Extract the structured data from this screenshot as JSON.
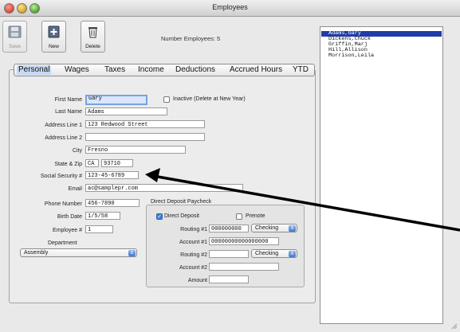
{
  "window": {
    "title": "Employees"
  },
  "toolbar": {
    "save": "Save",
    "new": "New",
    "delete": "Delete",
    "num_employees": "Number Employees:  5"
  },
  "tabs": [
    "Personal",
    "Wages",
    "Taxes",
    "Income",
    "Deductions",
    "Accrued Hours",
    "YTD"
  ],
  "form": {
    "first_name_label": "First Name",
    "first_name": "Gary",
    "inactive_label": "Inactive (Delete at New Year)",
    "last_name_label": "Last Name",
    "last_name": "Adams",
    "address1_label": "Address Line 1",
    "address1": "123 Redwood Street",
    "address2_label": "Address Line 2",
    "address2": "",
    "city_label": "City",
    "city": "Fresno",
    "state_zip_label": "State & Zip",
    "state": "CA",
    "zip": "93710",
    "ssn_label": "Social Security #",
    "ssn": "123-45-6789",
    "email_label": "Email",
    "email": "ac@samplepr.com",
    "phone_label": "Phone Number",
    "phone": "456-7890",
    "birth_label": "Birth Date",
    "birth": "1/5/58",
    "employee_no_label": "Employee #",
    "employee_no": "1",
    "department_label": "Department",
    "department": "Assembly"
  },
  "direct_deposit": {
    "title": "Direct Deposit Paycheck",
    "dd_label": "Direct Deposit",
    "prenote_label": "Prenote",
    "routing1_label": "Routing #1",
    "routing1": "000000000",
    "type1": "Checking",
    "account1_label": "Account #1",
    "account1": "00000000000000000",
    "routing2_label": "Routing #2",
    "routing2": "",
    "type2": "Checking",
    "account2_label": "Account #2",
    "account2": "",
    "amount_label": "Amount",
    "amount": ""
  },
  "employees": [
    "Adams,Gary",
    "Dickens,Chuck",
    "Griffin,Marj",
    "Hill,Allison",
    "Morrison,Leila"
  ],
  "selected_employee": "Adams,Gary",
  "icons": {
    "save": "save-icon",
    "new": "new-icon",
    "delete": "trash-icon",
    "resize": "resize-grip-icon"
  },
  "colors": {
    "selection": "#1f3ca8",
    "focus_field": "#d9e6fb",
    "arrow": "#000000"
  }
}
